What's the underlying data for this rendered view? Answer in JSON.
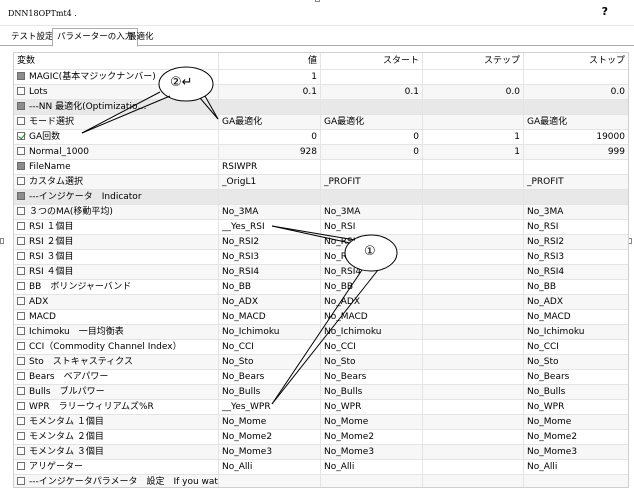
{
  "window": {
    "title": "DNN18OPTmt4 .",
    "help": "?"
  },
  "tabs": [
    "テスト設定",
    "パラメーターの入力",
    "最適化"
  ],
  "table": {
    "headers": [
      "変数",
      "値",
      "スタート",
      "ステップ",
      "ストップ"
    ],
    "rows": [
      {
        "check": "filled",
        "name": "MAGIC(基本マジックナンバー)",
        "v": "1",
        "start": "",
        "step": "",
        "stop": "",
        "numeric": true
      },
      {
        "check": "empty",
        "name": "Lots",
        "v": "0.1",
        "start": "0.1",
        "step": "0.0",
        "stop": "0.0",
        "numeric": true
      },
      {
        "check": "filled",
        "name": "---NN 最適化(Optimizatio…",
        "v": "",
        "start": "",
        "step": "",
        "stop": "",
        "numeric": false
      },
      {
        "check": "empty",
        "name": "モード選択",
        "v": "GA最適化",
        "start": "GA最適化",
        "step": "",
        "stop": "GA最適化",
        "numeric": false
      },
      {
        "check": "checked",
        "name": "GA回数",
        "v": "0",
        "start": "0",
        "step": "1",
        "stop": "19000",
        "numeric": true
      },
      {
        "check": "empty",
        "name": "Normal_1000",
        "v": "928",
        "start": "0",
        "step": "1",
        "stop": "999",
        "numeric": true
      },
      {
        "check": "filled",
        "name": "FileName",
        "v": "RSIWPR",
        "start": "",
        "step": "",
        "stop": "",
        "numeric": false
      },
      {
        "check": "empty",
        "name": "カスタム選択",
        "v": "_OrigL1",
        "start": "_PROFIT",
        "step": "",
        "stop": "_PROFIT",
        "numeric": false
      },
      {
        "check": "filled",
        "name": "---インジケータ　Indicator",
        "v": "",
        "start": "",
        "step": "",
        "stop": "",
        "numeric": false
      },
      {
        "check": "empty",
        "name": "３つのMA(移動平均)",
        "v": "No_3MA",
        "start": "No_3MA",
        "step": "",
        "stop": "No_3MA",
        "numeric": false
      },
      {
        "check": "empty",
        "name": "RSI １個目",
        "v": "__Yes_RSI",
        "start": "No_RSI",
        "step": "",
        "stop": "No_RSI",
        "numeric": false
      },
      {
        "check": "empty",
        "name": "RSI ２個目",
        "v": "No_RSI2",
        "start": "No_RSI2",
        "step": "",
        "stop": "No_RSI2",
        "numeric": false
      },
      {
        "check": "empty",
        "name": "RSI ３個目",
        "v": "No_RSI3",
        "start": "No_RSI3",
        "step": "",
        "stop": "No_RSI3",
        "numeric": false
      },
      {
        "check": "empty",
        "name": "RSI ４個目",
        "v": "No_RSI4",
        "start": "No_RSI4",
        "step": "",
        "stop": "No_RSI4",
        "numeric": false
      },
      {
        "check": "empty",
        "name": "BB　ボリンジャーバンド",
        "v": "No_BB",
        "start": "No_BB",
        "step": "",
        "stop": "No_BB",
        "numeric": false
      },
      {
        "check": "empty",
        "name": "ADX",
        "v": "No_ADX",
        "start": "No_ADX",
        "step": "",
        "stop": "No_ADX",
        "numeric": false
      },
      {
        "check": "empty",
        "name": "MACD",
        "v": "No_MACD",
        "start": "No_MACD",
        "step": "",
        "stop": "No_MACD",
        "numeric": false
      },
      {
        "check": "empty",
        "name": "Ichimoku　一目均衡表",
        "v": "No_Ichimoku",
        "start": "No_Ichimoku",
        "step": "",
        "stop": "No_Ichimoku",
        "numeric": false
      },
      {
        "check": "empty",
        "name": "CCI（Commodity Channel Index）",
        "v": "No_CCI",
        "start": "No_CCI",
        "step": "",
        "stop": "No_CCI",
        "numeric": false
      },
      {
        "check": "empty",
        "name": "Sto　ストキャスティクス",
        "v": "No_Sto",
        "start": "No_Sto",
        "step": "",
        "stop": "No_Sto",
        "numeric": false
      },
      {
        "check": "empty",
        "name": "Bears　ベアパワー",
        "v": "No_Bears",
        "start": "No_Bears",
        "step": "",
        "stop": "No_Bears",
        "numeric": false
      },
      {
        "check": "empty",
        "name": "Bulls　ブルパワー",
        "v": "No_Bulls",
        "start": "No_Bulls",
        "step": "",
        "stop": "No_Bulls",
        "numeric": false
      },
      {
        "check": "empty",
        "name": "WPR　ラリーウィリアムズ%R",
        "v": "__Yes_WPR",
        "start": "No_WPR",
        "step": "",
        "stop": "No_WPR",
        "numeric": false
      },
      {
        "check": "empty",
        "name": "モメンタム １個目",
        "v": "No_Mome",
        "start": "No_Mome",
        "step": "",
        "stop": "No_Mome",
        "numeric": false
      },
      {
        "check": "empty",
        "name": "モメンタム ２個目",
        "v": "No_Mome2",
        "start": "No_Mome2",
        "step": "",
        "stop": "No_Mome2",
        "numeric": false
      },
      {
        "check": "empty",
        "name": "モメンタム ３個目",
        "v": "No_Mome3",
        "start": "No_Mome3",
        "step": "",
        "stop": "No_Mome3",
        "numeric": false
      },
      {
        "check": "empty",
        "name": "アリゲーター",
        "v": "No_Alli",
        "start": "No_Alli",
        "step": "",
        "stop": "No_Alli",
        "numeric": false
      },
      {
        "check": "empty",
        "name": "---インジケータパラメータ　設定　If you wate fix …",
        "v": "",
        "start": "",
        "step": "",
        "stop": "",
        "numeric": false
      }
    ]
  },
  "annotations": {
    "callout1": "①",
    "callout2": "②↵"
  },
  "colors": {
    "checkbox_fill": "#8c8c8c",
    "check_green": "#2a7a2a",
    "grid_line": "#e4e4e4"
  }
}
